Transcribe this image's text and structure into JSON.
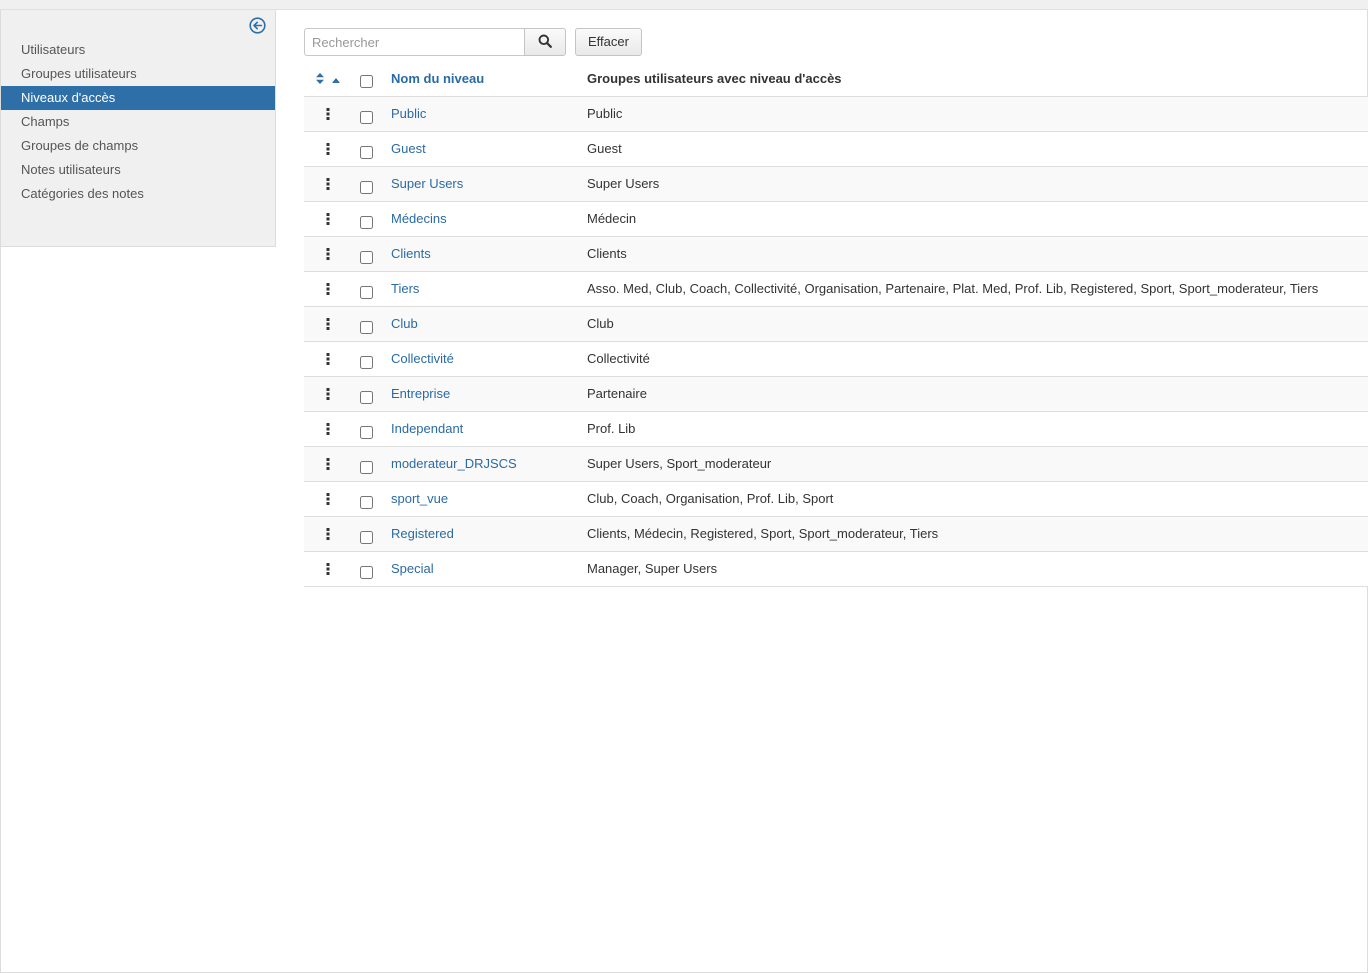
{
  "sidebar": {
    "items": [
      {
        "label": "Utilisateurs",
        "active": false
      },
      {
        "label": "Groupes utilisateurs",
        "active": false
      },
      {
        "label": "Niveaux d'accès",
        "active": true
      },
      {
        "label": "Champs",
        "active": false
      },
      {
        "label": "Groupes de champs",
        "active": false
      },
      {
        "label": "Notes utilisateurs",
        "active": false
      },
      {
        "label": "Catégories des notes",
        "active": false
      }
    ],
    "collapse_icon": "arrow-left-circle-icon"
  },
  "toolbar": {
    "search_placeholder": "Rechercher",
    "search_value": "",
    "search_icon": "search-icon",
    "clear_label": "Effacer"
  },
  "table": {
    "header": {
      "name": "Nom du niveau",
      "groups": "Groupes utilisateurs avec niveau d'accès"
    },
    "rows": [
      {
        "name": "Public",
        "groups": "Public"
      },
      {
        "name": "Guest",
        "groups": "Guest"
      },
      {
        "name": "Super Users",
        "groups": "Super Users"
      },
      {
        "name": "Médecins",
        "groups": "Médecin"
      },
      {
        "name": "Clients",
        "groups": "Clients"
      },
      {
        "name": "Tiers",
        "groups": "Asso. Med, Club, Coach, Collectivité, Organisation, Partenaire, Plat. Med, Prof. Lib, Registered, Sport, Sport_moderateur, Tiers"
      },
      {
        "name": "Club",
        "groups": "Club"
      },
      {
        "name": "Collectivité",
        "groups": "Collectivité"
      },
      {
        "name": "Entreprise",
        "groups": "Partenaire"
      },
      {
        "name": "Independant",
        "groups": "Prof. Lib"
      },
      {
        "name": "moderateur_DRJSCS",
        "groups": "Super Users, Sport_moderateur"
      },
      {
        "name": "sport_vue",
        "groups": "Club, Coach, Organisation, Prof. Lib, Sport"
      },
      {
        "name": "Registered",
        "groups": "Clients, Médecin, Registered, Sport, Sport_moderateur, Tiers"
      },
      {
        "name": "Special",
        "groups": "Manager, Super Users"
      }
    ]
  },
  "colors": {
    "accent": "#2f6fa7",
    "link": "#2a6aa5",
    "sidebar_bg": "#f0f0f0"
  }
}
